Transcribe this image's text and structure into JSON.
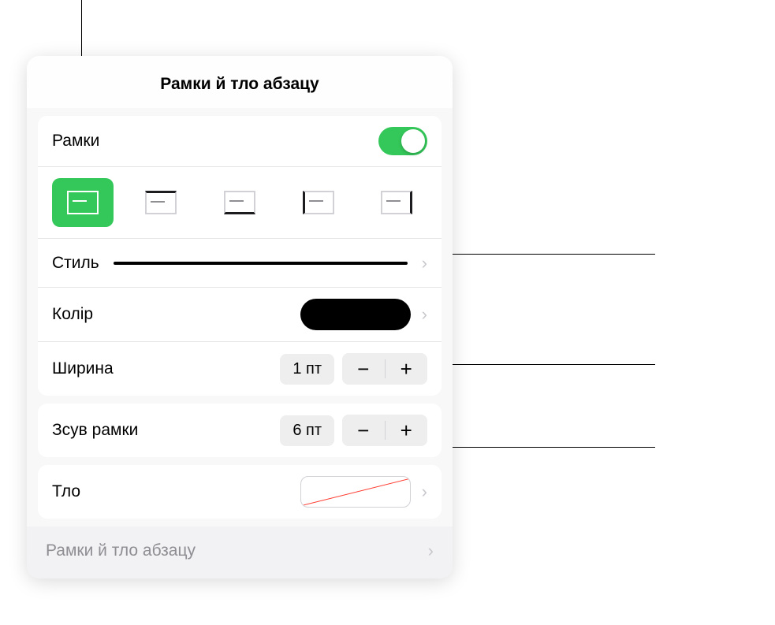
{
  "title": "Рамки й тло абзацу",
  "borders": {
    "label": "Рамки",
    "toggle_on": true
  },
  "style": {
    "label": "Стиль"
  },
  "color": {
    "label": "Колір",
    "value": "#000000"
  },
  "width": {
    "label": "Ширина",
    "value": "1 пт"
  },
  "offset": {
    "label": "Зсув рамки",
    "value": "6 пт"
  },
  "background": {
    "label": "Тло"
  },
  "bottom_label": "Рамки й тло абзацу"
}
